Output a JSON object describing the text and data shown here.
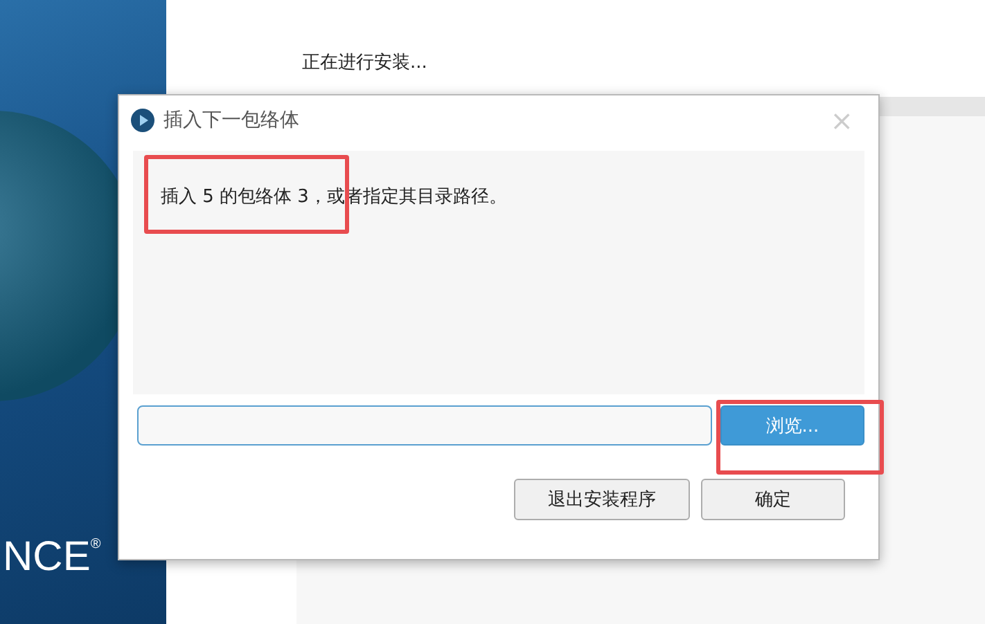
{
  "background": {
    "brand": "NCE",
    "brand_mark": "®",
    "status": "正在进行安装..."
  },
  "dialog": {
    "title": "插入下一包络体",
    "message": "插入 5 的包络体 3，或者指定其目录路径。",
    "close": "×",
    "buttons": [
      {
        "label": "浏览...",
        "kind": "primary"
      },
      {
        "label": "退出安装程序",
        "kind": "secondary"
      },
      {
        "label": "确定",
        "kind": "secondary"
      }
    ]
  }
}
